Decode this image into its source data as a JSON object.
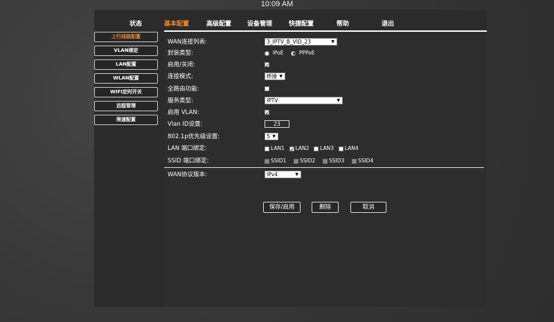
{
  "status_bar": {
    "time": "10:09 AM"
  },
  "topnav": {
    "items": [
      {
        "label": "状态"
      },
      {
        "label": "基本配置"
      },
      {
        "label": "高级配置"
      },
      {
        "label": "设备管理"
      },
      {
        "label": "快捷配置"
      },
      {
        "label": "帮助"
      },
      {
        "label": "退出"
      }
    ],
    "active": "基本配置"
  },
  "sidebar": {
    "items": [
      {
        "label": "上行线路配置"
      },
      {
        "label": "VLAN绑定"
      },
      {
        "label": "LAN配置"
      },
      {
        "label": "WLAN配置"
      },
      {
        "label": "WIFI定时开关"
      },
      {
        "label": "远程管理"
      },
      {
        "label": "限速配置"
      }
    ],
    "active": "上行线路配置"
  },
  "form": {
    "wan_list": {
      "label": "WAN连接列表:",
      "value": "3_IPTV_B_VID_23"
    },
    "encap": {
      "label": "封装类型:",
      "options": [
        "IPoE",
        "PPPoE"
      ],
      "selected": "PPPoE"
    },
    "enable": {
      "label": "启用/关闭:",
      "checked": true
    },
    "conn_mode": {
      "label": "连接模式:",
      "value": "桥接"
    },
    "routing": {
      "label": "全路由功能:",
      "checked": false
    },
    "service": {
      "label": "服务类型:",
      "value": "IPTV"
    },
    "vlan_enable": {
      "label": "启用 VLAN:",
      "checked": true
    },
    "vlan_id": {
      "label": "Vlan ID设置:",
      "value": "23"
    },
    "priority": {
      "label": "802.1p优先级设置:",
      "value": "5"
    },
    "lan_bind": {
      "label": "LAN 端口绑定:",
      "ports": [
        {
          "name": "LAN1",
          "checked": false
        },
        {
          "name": "LAN2",
          "checked": true
        },
        {
          "name": "LAN3",
          "checked": false
        },
        {
          "name": "LAN4",
          "checked": false
        }
      ]
    },
    "ssid_bind": {
      "label": "SSID 端口绑定:",
      "ports": [
        {
          "name": "SSID1"
        },
        {
          "name": "SSID2"
        },
        {
          "name": "SSID3"
        },
        {
          "name": "SSID4"
        }
      ]
    },
    "wan_protocol": {
      "label": "WAN协议版本:",
      "value": "IPv4"
    }
  },
  "actions": {
    "save": "保存/启用",
    "delete": "删除",
    "cancel": "取消"
  },
  "colors": {
    "accent": "#f08a2c",
    "panel": "#2d2d2d"
  }
}
